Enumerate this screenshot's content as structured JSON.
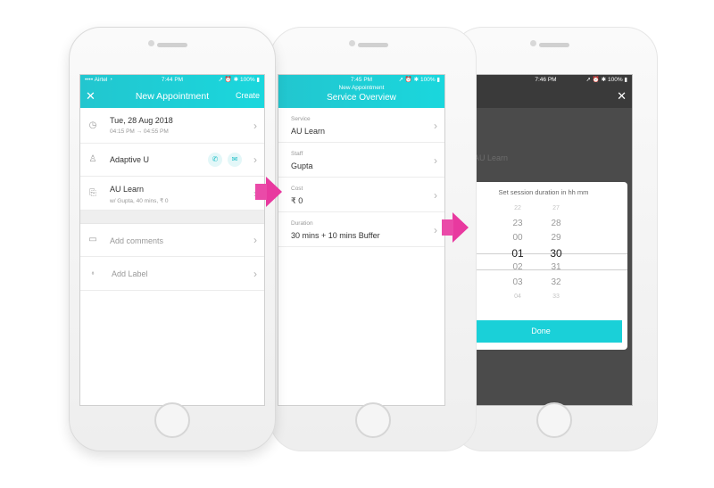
{
  "colors": {
    "header_teal": "#22c6cf",
    "accent_teal": "#1ad0d8",
    "arrow_pink": "#e8399f",
    "overlay_dark": "#4b4b4b"
  },
  "screen1": {
    "status": {
      "carrier": "Airtel",
      "time": "7:44 PM",
      "battery": "100%"
    },
    "header": {
      "title": "New Appointment",
      "create": "Create"
    },
    "rows": {
      "date": {
        "main": "Tue, 28 Aug 2018",
        "sub": "04:15 PM → 04:55 PM"
      },
      "client": {
        "main": "Adaptive U"
      },
      "service": {
        "main": "AU Learn",
        "sub": "w/ Gupta, 40 mins, ₹ 0"
      },
      "comments": {
        "main": "Add comments"
      },
      "label": {
        "main": "Add Label"
      }
    }
  },
  "screen2": {
    "status": {
      "time": "7:45 PM",
      "battery": "100%"
    },
    "header": {
      "suptitle": "New Appointment",
      "title": "Service Overview"
    },
    "fields": [
      {
        "label": "Service",
        "value": "AU Learn"
      },
      {
        "label": "Staff",
        "value": "Gupta"
      },
      {
        "label": "Cost",
        "value": "₹ 0"
      },
      {
        "label": "Duration",
        "value": "30 mins + 10 mins Buffer"
      }
    ]
  },
  "screen3": {
    "status": {
      "time": "7:46 PM",
      "battery": "100%"
    },
    "ghost": {
      "value": "AU Learn"
    },
    "modal": {
      "title": "Set session duration in hh mm",
      "hours": [
        "22",
        "23",
        "00",
        "01",
        "02",
        "03",
        "04"
      ],
      "minutes": [
        "27",
        "28",
        "29",
        "30",
        "31",
        "32",
        "33"
      ],
      "done": "Done"
    }
  }
}
